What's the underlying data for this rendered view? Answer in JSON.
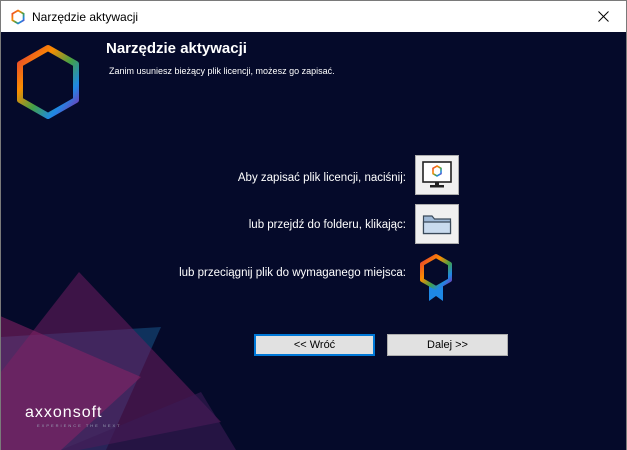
{
  "window": {
    "title": "Narzędzie aktywacji"
  },
  "header": {
    "title": "Narzędzie aktywacji",
    "subtitle": "Zanim usuniesz bieżący plik licencji, możesz go zapisać."
  },
  "actions": {
    "save_label": "Aby zapisać plik licencji, naciśnij:",
    "folder_label": "lub przejdź do folderu, klikając:",
    "drag_label": "lub przeciągnij plik do wymaganego miejsca:"
  },
  "buttons": {
    "back": "<< Wróć",
    "next": "Dalej >>"
  },
  "brand": {
    "name": "axxonsoft",
    "tagline": "EXPERIENCE THE NEXT"
  },
  "icons": {
    "app": "hexagon-logo-icon",
    "close": "close-icon",
    "save": "monitor-save-icon",
    "folder": "folder-icon",
    "drag": "license-badge-icon"
  },
  "colors": {
    "background": "#050a2a",
    "accent": "#0078d7"
  }
}
